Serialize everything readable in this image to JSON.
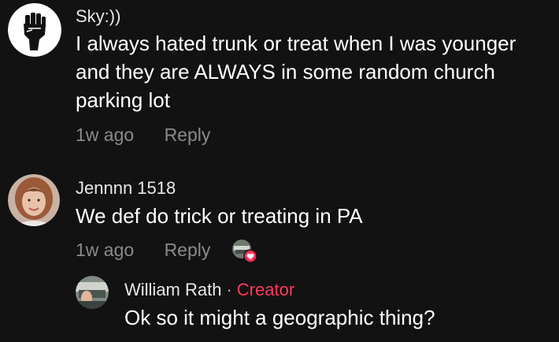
{
  "comments": [
    {
      "username": "Sky:))",
      "lines": [
        "I always hated trunk or treat when I was younger",
        "and they are ALWAYS in some random church",
        "parking lot"
      ],
      "time": "1w ago",
      "reply_label": "Reply"
    },
    {
      "username": "Jennnn 1518",
      "lines": [
        "We def do trick or treating in PA"
      ],
      "time": "1w ago",
      "reply_label": "Reply"
    }
  ],
  "reply": {
    "username": "William Rath",
    "separator": "·",
    "creator_label": "Creator",
    "lines": [
      "Ok so it might a geographic thing?"
    ]
  },
  "icons": {
    "avatar1": "raised-fist-icon",
    "creator_liked": "heart-icon"
  },
  "colors": {
    "background": "#121212",
    "creator_accent": "#ff3b5c",
    "meta_text": "#8a8a8a"
  }
}
